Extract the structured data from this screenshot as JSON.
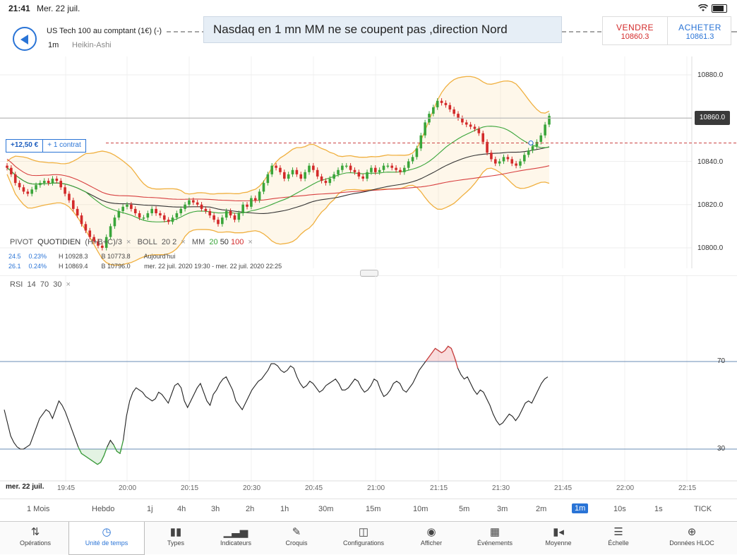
{
  "status": {
    "time": "21:41",
    "date": "Mer. 22 juil.",
    "icons": [
      "wifi-icon",
      "battery-icon"
    ]
  },
  "header": {
    "instrument": "US Tech 100 au comptant (1€) (-)",
    "timeframe": "1m",
    "chart_type": "Heikin-Ashi",
    "note": "Nasdaq en 1 mn MM ne se coupent pas ,direction Nord",
    "sell": {
      "label": "VENDRE",
      "price": "10860.3"
    },
    "buy": {
      "label": "ACHETER",
      "price": "10861.3"
    }
  },
  "price_axis": {
    "labels": [
      "10880.0",
      "10860.0",
      "10840.0",
      "10820.0",
      "10800.0"
    ],
    "current": "10860.0"
  },
  "position": {
    "pl": "+12,50 €",
    "size": "+ 1 contrat"
  },
  "legend": {
    "pivot": "PIVOT",
    "pivot_mode": "QUOTIDIEN",
    "pivot_formula": "(H+B+C)/3",
    "boll": "BOLL",
    "boll_p1": "20",
    "boll_p2": "2",
    "mm": "MM",
    "mm_p1": "20",
    "mm_p2": "50",
    "mm_p3": "100",
    "close": "×"
  },
  "info": [
    {
      "val": "24.5",
      "pct": "0.23%",
      "h": "H 10928.3",
      "b": "B 10773.8",
      "period": "Aujourd'hui"
    },
    {
      "val": "26.1",
      "pct": "0.24%",
      "h": "H 10869.4",
      "b": "B 10796.0",
      "period": "mer. 22 juil. 2020 19:30 - mer. 22 juil. 2020 22:25"
    }
  ],
  "rsi": {
    "label": "RSI",
    "p1": "14",
    "p2": "70",
    "p3": "30",
    "levels": [
      "70",
      "30"
    ]
  },
  "x_axis": {
    "date_tag": "mer. 22 juil.",
    "labels": [
      "19:45",
      "20:00",
      "20:15",
      "20:30",
      "20:45",
      "21:00",
      "21:15",
      "21:30",
      "21:45",
      "22:00",
      "22:15"
    ]
  },
  "timeframes": [
    "1 Mois",
    "Hebdo",
    "1j",
    "4h",
    "3h",
    "2h",
    "1h",
    "30m",
    "15m",
    "10m",
    "5m",
    "3m",
    "2m",
    "1m",
    "10s",
    "1s",
    "TICK"
  ],
  "active_timeframe": "1m",
  "toolbar": [
    {
      "label": "Opérations",
      "icon": "sort-arrows-icon"
    },
    {
      "label": "Unité de temps",
      "icon": "clock-icon"
    },
    {
      "label": "Types",
      "icon": "candlestick-icon"
    },
    {
      "label": "Indicateurs",
      "icon": "bar-chart-icon"
    },
    {
      "label": "Croquis",
      "icon": "pencil-icon"
    },
    {
      "label": "Configurations",
      "icon": "layout-icon"
    },
    {
      "label": "Afficher",
      "icon": "eye-icon"
    },
    {
      "label": "Événements",
      "icon": "calendar-icon"
    },
    {
      "label": "Moyenne",
      "icon": "moving-average-icon"
    },
    {
      "label": "Échelle",
      "icon": "scale-icon"
    },
    {
      "label": "Données HLOC",
      "icon": "crosshair-icon"
    }
  ],
  "colors": {
    "accent": "#2a74d6",
    "up": "#3aa53a",
    "down": "#d32a2a",
    "boll": "#f0b040",
    "mm20": "#3aa53a",
    "mm50": "#333333",
    "mm100": "#d84040"
  },
  "chart_data": [
    {
      "type": "candlestick",
      "name": "US Tech 100 1m Heikin-Ashi",
      "ylim": [
        10795,
        10890
      ],
      "x_labels": [
        "19:45",
        "20:00",
        "20:15",
        "20:30",
        "20:45",
        "21:00",
        "21:15",
        "21:30",
        "21:45"
      ],
      "y_ticks": [
        10880,
        10860,
        10840,
        10820,
        10800
      ],
      "close": [
        10837,
        10834,
        10830,
        10828,
        10826,
        10825,
        10827,
        10829,
        10830,
        10831,
        10830,
        10832,
        10831,
        10828,
        10825,
        10822,
        10818,
        10815,
        10811,
        10808,
        10805,
        10803,
        10801,
        10800,
        10805,
        10810,
        10814,
        10817,
        10819,
        10820,
        10818,
        10816,
        10814,
        10814,
        10816,
        10818,
        10816,
        10815,
        10813,
        10812,
        10814,
        10816,
        10818,
        10820,
        10822,
        10821,
        10820,
        10818,
        10817,
        10815,
        10813,
        10811,
        10814,
        10817,
        10815,
        10813,
        10816,
        10820,
        10819,
        10823,
        10822,
        10826,
        10830,
        10834,
        10838,
        10837,
        10835,
        10832,
        10834,
        10836,
        10834,
        10832,
        10835,
        10838,
        10836,
        10833,
        10831,
        10830,
        10832,
        10834,
        10836,
        10838,
        10838,
        10836,
        10835,
        10833,
        10832,
        10835,
        10837,
        10835,
        10836,
        10838,
        10838,
        10837,
        10836,
        10835,
        10837,
        10840,
        10842,
        10846,
        10852,
        10858,
        10862,
        10865,
        10868,
        10867,
        10866,
        10864,
        10862,
        10860,
        10858,
        10857,
        10856,
        10855,
        10853,
        10849,
        10844,
        10841,
        10839,
        10840,
        10842,
        10841,
        10839,
        10838,
        10840,
        10843,
        10845,
        10847,
        10849,
        10852,
        10857,
        10861
      ],
      "series": [
        {
          "name": "BOLL 20 2",
          "color": "#f0b040"
        },
        {
          "name": "MM 20",
          "color": "#3aa53a"
        },
        {
          "name": "MM 50",
          "color": "#333333"
        },
        {
          "name": "MM 100",
          "color": "#d84040"
        }
      ]
    },
    {
      "type": "line",
      "name": "RSI 14",
      "ylim": [
        0,
        100
      ],
      "levels": [
        70,
        30
      ],
      "values": [
        48,
        42,
        36,
        33,
        31,
        30,
        30,
        31,
        32,
        36,
        40,
        44,
        46,
        48,
        47,
        44,
        48,
        52,
        50,
        47,
        43,
        39,
        35,
        31,
        28,
        27,
        26,
        25,
        24,
        23,
        24,
        27,
        31,
        34,
        32,
        29,
        28,
        34,
        45,
        52,
        56,
        58,
        57,
        56,
        54,
        53,
        52,
        53,
        56,
        55,
        53,
        51,
        55,
        59,
        60,
        58,
        52,
        49,
        52,
        55,
        58,
        60,
        56,
        52,
        50,
        55,
        57,
        60,
        62,
        63,
        60,
        57,
        52,
        50,
        48,
        51,
        54,
        57,
        59,
        61,
        62,
        64,
        66,
        69,
        69,
        68,
        66,
        65,
        66,
        68,
        67,
        63,
        60,
        58,
        59,
        61,
        60,
        58,
        56,
        57,
        59,
        60,
        61,
        62,
        60,
        57,
        57,
        58,
        60,
        62,
        61,
        58,
        56,
        57,
        59,
        62,
        61,
        57,
        54,
        55,
        57,
        60,
        61,
        60,
        57,
        56,
        58,
        60,
        63,
        66,
        68,
        70,
        72,
        74,
        76,
        75,
        74,
        75,
        77,
        76,
        72,
        67,
        64,
        62,
        63,
        60,
        57,
        55,
        57,
        56,
        53,
        50,
        46,
        43,
        41,
        42,
        44,
        46,
        45,
        43,
        45,
        48,
        51,
        52,
        51,
        54,
        57,
        60,
        62,
        63
      ]
    }
  ]
}
